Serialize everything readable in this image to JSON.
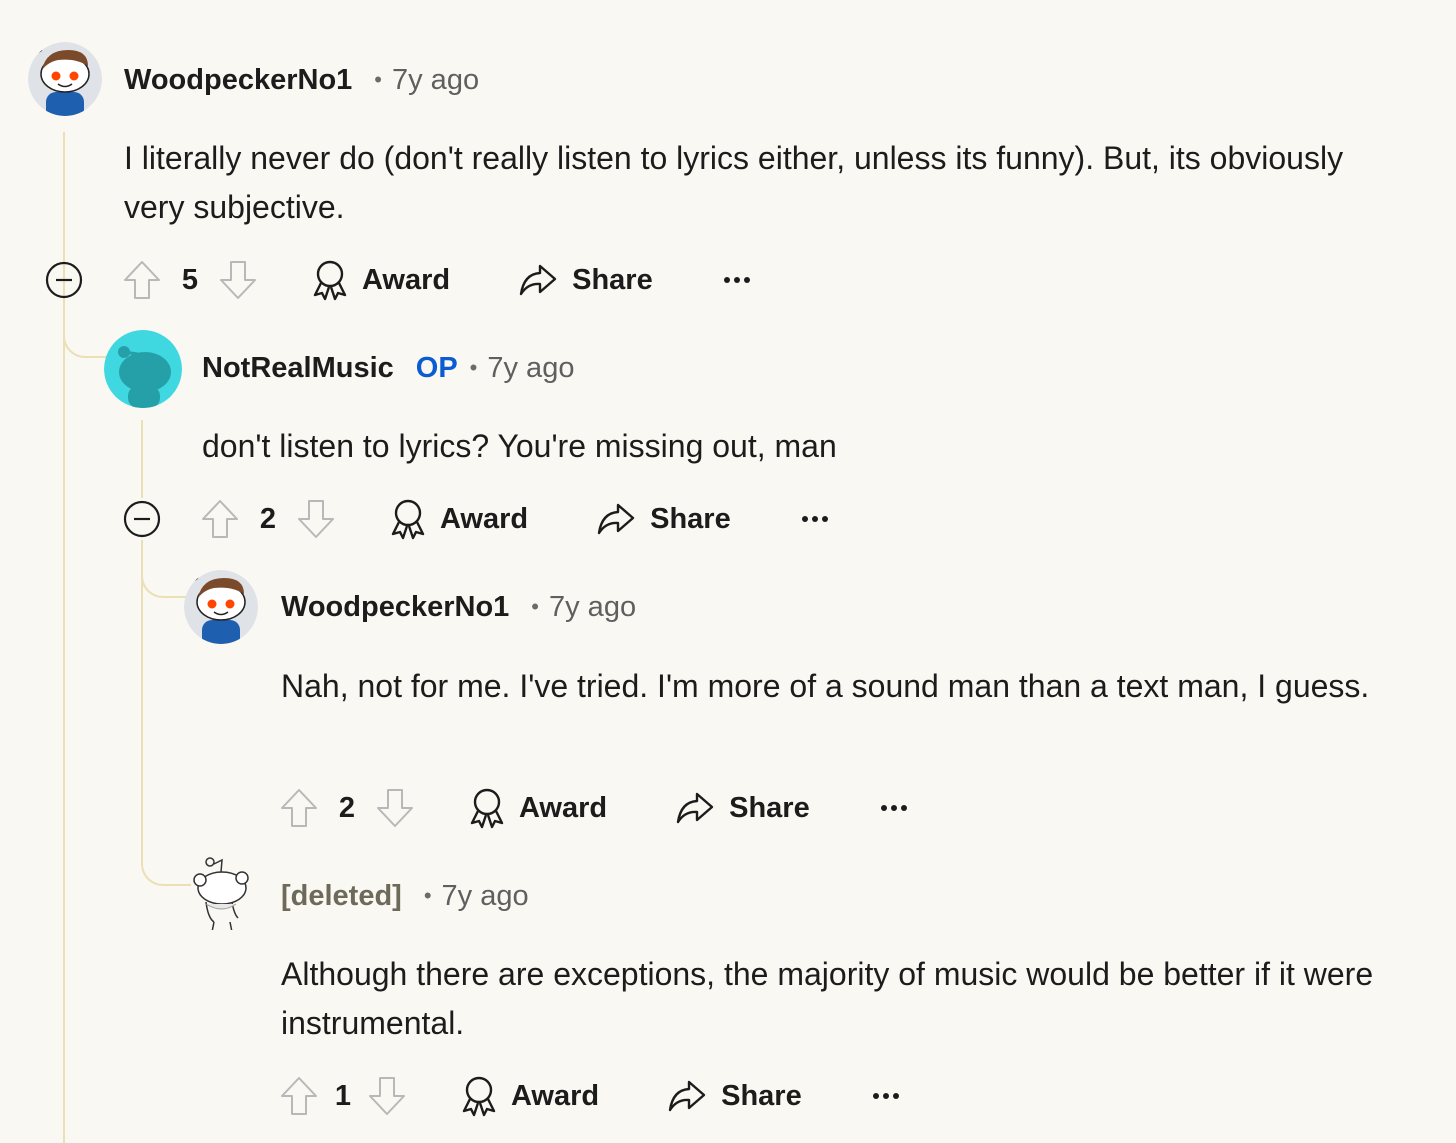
{
  "comments": [
    {
      "author": "WoodpeckerNo1",
      "op_badge": "",
      "time": "7y ago",
      "body": "I literally never do (don't really listen to lyrics either, unless its funny). But, its obviously very subjective.",
      "score": "5",
      "avatar_icon": "snoo-avatar-brown-hair"
    },
    {
      "author": "NotRealMusic",
      "op_badge": "OP",
      "time": "7y ago",
      "body": "don't listen to lyrics? You're missing out, man",
      "score": "2",
      "avatar_icon": "snoo-avatar-teal"
    },
    {
      "author": "WoodpeckerNo1",
      "op_badge": "",
      "time": "7y ago",
      "body": "Nah, not for me. I've tried. I'm more of a sound man than a text man, I guess.",
      "score": "2",
      "avatar_icon": "snoo-avatar-brown-hair"
    },
    {
      "author": "[deleted]",
      "op_badge": "",
      "time": "7y ago",
      "body": "Although there are exceptions, the majority of music would be better if it were instrumental.",
      "score": "1",
      "avatar_icon": "snoo-avatar-deleted"
    }
  ],
  "actions": {
    "award_label": "Award",
    "share_label": "Share"
  },
  "colors": {
    "background": "#faf8f3",
    "thread_line": "#eadfb7",
    "op_badge": "#0b5bd3",
    "teal_avatar": "#3fd8e0"
  }
}
